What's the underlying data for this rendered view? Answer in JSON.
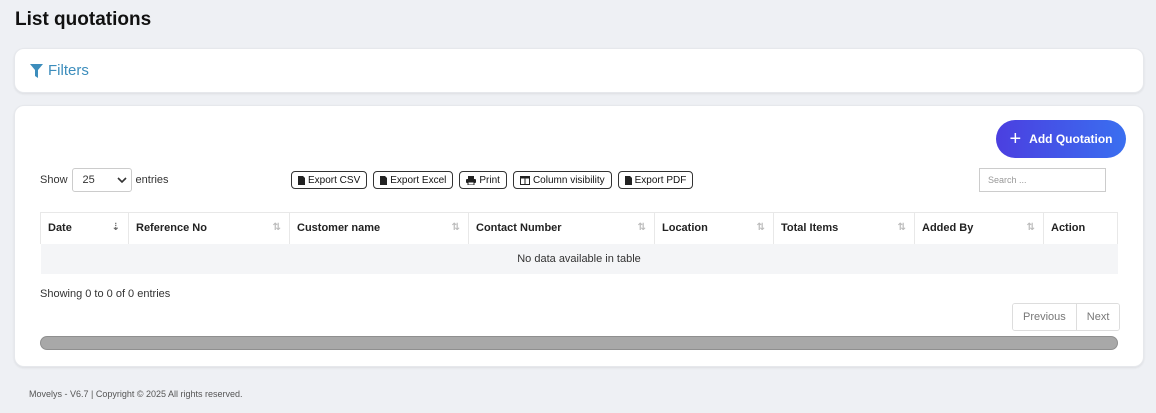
{
  "page": {
    "title": "List quotations"
  },
  "filters": {
    "label": "Filters",
    "icon": "filter-icon"
  },
  "toolbar": {
    "add_label": "Add Quotation",
    "show_label": "Show",
    "entries_label": "entries",
    "page_length": "25",
    "search_placeholder": "Search ...",
    "buttons": {
      "csv": "Export CSV",
      "excel": "Export Excel",
      "print": "Print",
      "colvis": "Column visibility",
      "pdf": "Export PDF"
    }
  },
  "table": {
    "columns": [
      "Date",
      "Reference No",
      "Customer name",
      "Contact Number",
      "Location",
      "Total Items",
      "Added By",
      "Action"
    ],
    "empty_message": "No data available in table"
  },
  "info": {
    "text": "Showing 0 to 0 of 0 entries"
  },
  "pagination": {
    "previous": "Previous",
    "next": "Next"
  },
  "footer": {
    "text": "Movelys - V6.7 | Copyright © 2025 All rights reserved."
  },
  "colors": {
    "accent_start": "#4b3fe0",
    "accent_end": "#3a6ff0",
    "link": "#3c8dbc"
  }
}
